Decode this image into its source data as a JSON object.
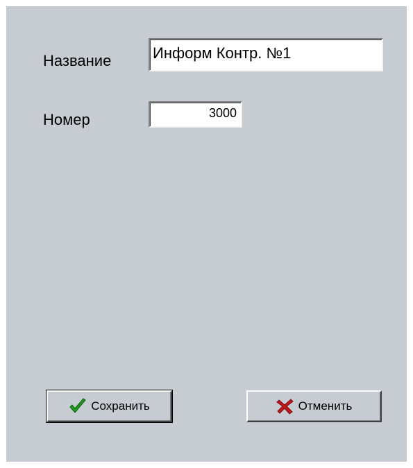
{
  "form": {
    "name_label": "Название",
    "name_value": "Информ Контр. №1",
    "number_label": "Номер",
    "number_value": "3000"
  },
  "buttons": {
    "save_label": "Сохранить",
    "save_icon": "green-checkmark-icon",
    "cancel_label": "Отменить",
    "cancel_icon": "red-x-icon"
  },
  "colors": {
    "dialog_background": "#c6ccd2",
    "check_green": "#1f9a1f",
    "cross_red": "#c0181c"
  }
}
